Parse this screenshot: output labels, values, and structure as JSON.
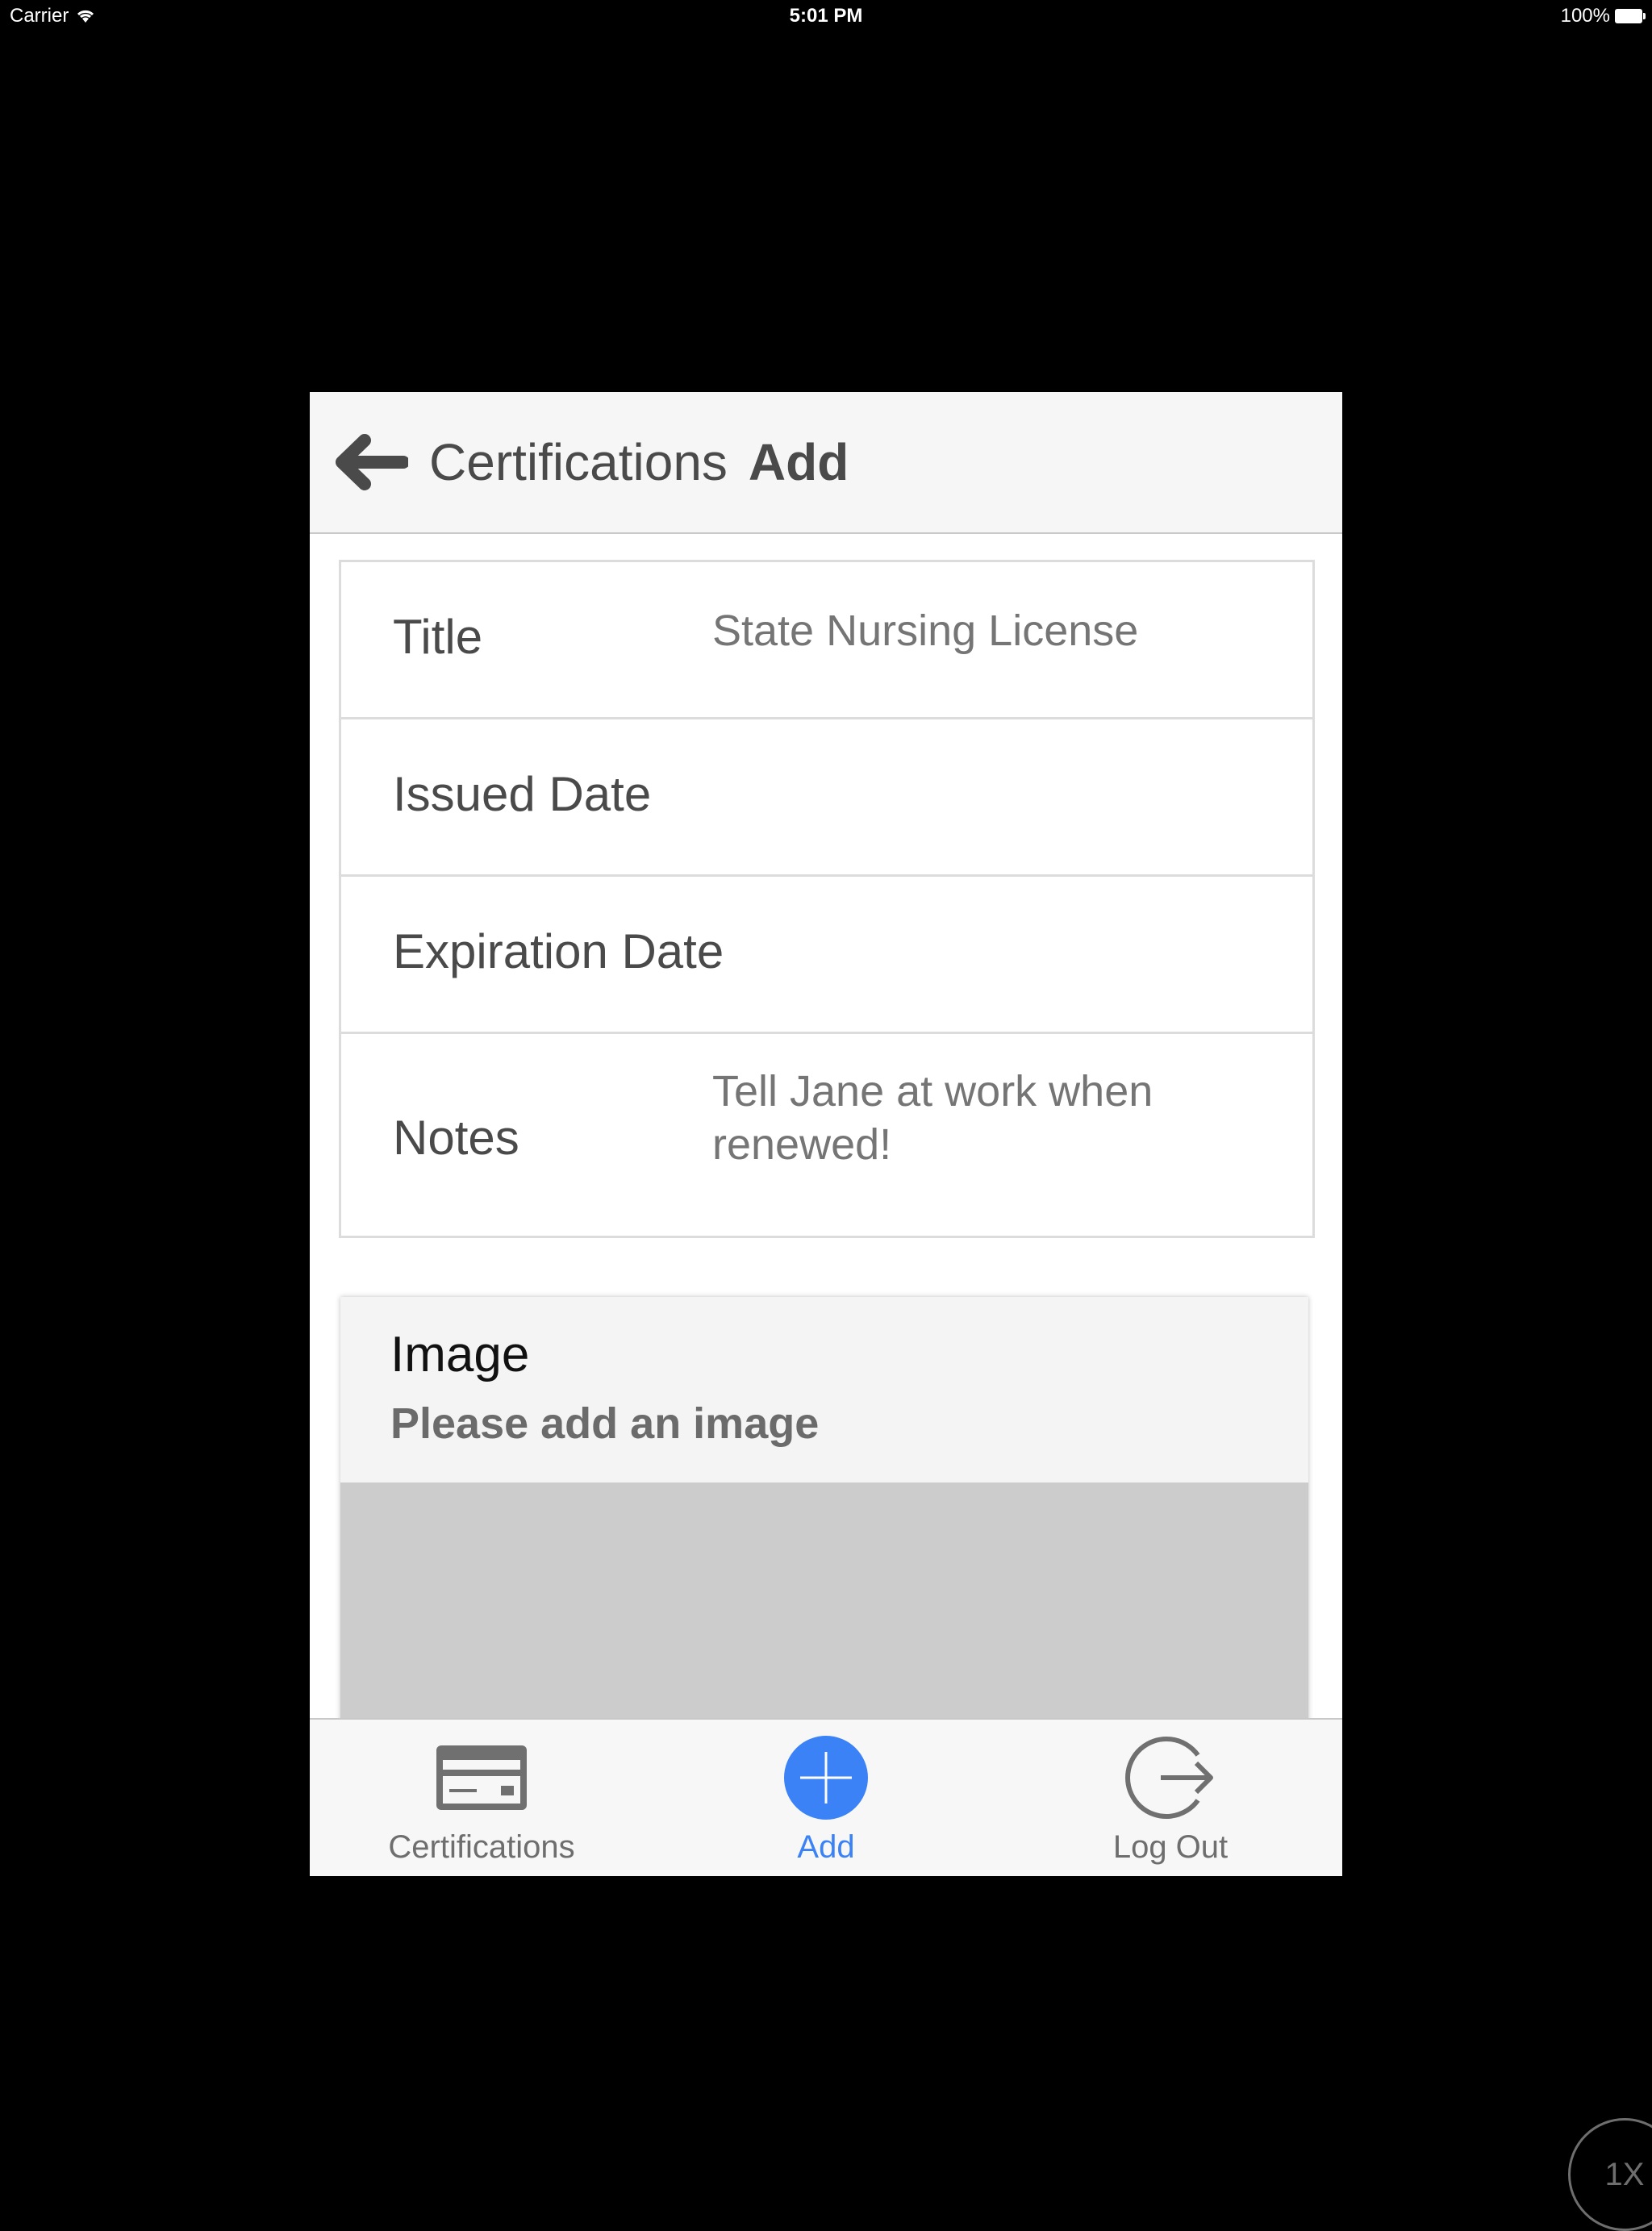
{
  "status_bar": {
    "carrier": "Carrier",
    "time": "5:01 PM",
    "battery": "100%"
  },
  "header": {
    "breadcrumb": "Certifications",
    "title": "Add"
  },
  "form": {
    "title_label": "Title",
    "title_placeholder": "State Nursing License",
    "issued_label": "Issued Date",
    "expiration_label": "Expiration Date",
    "notes_label": "Notes",
    "notes_placeholder": "Tell Jane at work when renewed!"
  },
  "image_card": {
    "title": "Image",
    "subtitle": "Please add an image"
  },
  "tabbar": {
    "tabs": [
      {
        "label": "Certifications",
        "icon": "credit-card-icon"
      },
      {
        "label": "Add",
        "icon": "plus-circle-icon"
      },
      {
        "label": "Log Out",
        "icon": "logout-icon"
      }
    ],
    "active_index": 1,
    "accent_color": "#3b82f6"
  },
  "zoom_badge": "1X"
}
